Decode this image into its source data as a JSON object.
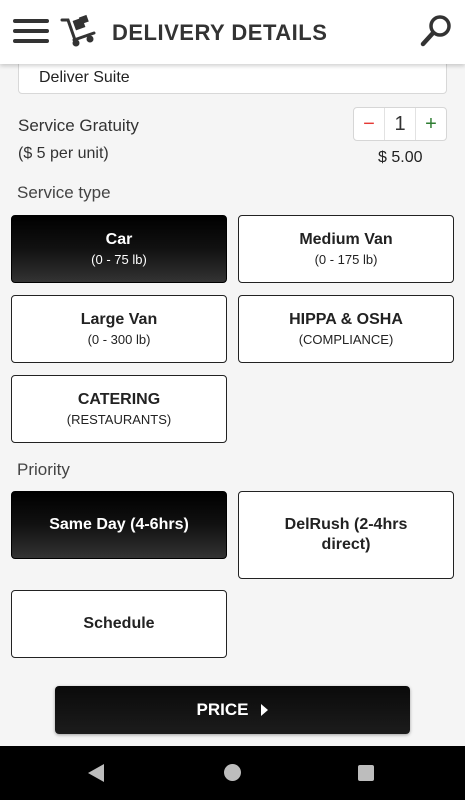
{
  "header": {
    "title": "DELIVERY DETAILS",
    "icons": [
      "menu-icon",
      "hand-truck-icon",
      "search-icon"
    ]
  },
  "suite_field": {
    "value": "Deliver Suite"
  },
  "gratuity": {
    "label": "Service Gratuity",
    "sub_label": "($ 5 per unit)",
    "minus": "−",
    "quantity": "1",
    "plus": "+",
    "total": "$ 5.00"
  },
  "service_type": {
    "label": "Service type",
    "options": [
      {
        "main": "Car",
        "sub": "(0 - 75 lb)",
        "selected": true
      },
      {
        "main": "Medium Van",
        "sub": "(0 - 175 lb)",
        "selected": false
      },
      {
        "main": "Large Van",
        "sub": "(0 - 300 lb)",
        "selected": false
      },
      {
        "main": "HIPPA & OSHA",
        "sub": "(COMPLIANCE)",
        "selected": false
      },
      {
        "main": "CATERING",
        "sub": "(RESTAURANTS)",
        "selected": false
      }
    ]
  },
  "priority": {
    "label": "Priority",
    "options": [
      {
        "main": "Same Day (4-6hrs)",
        "selected": true
      },
      {
        "main": "DelRush (2-4hrs direct)",
        "selected": false
      },
      {
        "main": "Schedule",
        "selected": false
      }
    ]
  },
  "price_button": {
    "label": "PRICE"
  },
  "colors": {
    "selected_bg": "#000000",
    "minus": "#e53935",
    "plus": "#2e7d32"
  },
  "system_nav": {
    "icons": [
      "back-icon",
      "home-icon",
      "recents-icon"
    ]
  }
}
